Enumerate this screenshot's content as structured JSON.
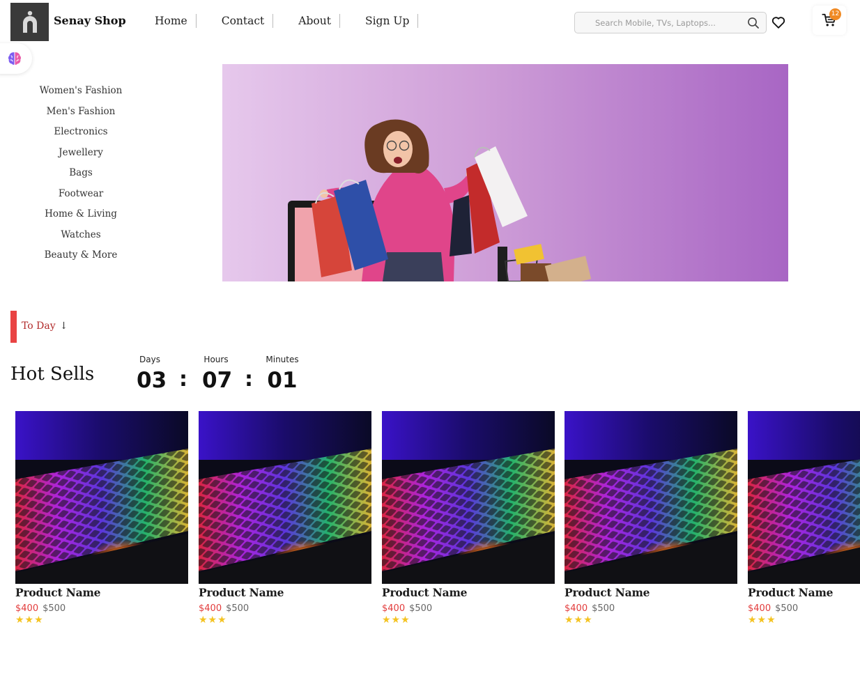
{
  "brand": {
    "name": "Senay Shop"
  },
  "nav": {
    "items": [
      "Home",
      "Contact",
      "About",
      "Sign Up"
    ]
  },
  "search": {
    "placeholder": "Search Mobile, TVs, Laptops..."
  },
  "cart": {
    "count": "12"
  },
  "categories": [
    "Women's Fashion",
    "Men's Fashion",
    "Electronics",
    "Jewellery",
    "Bags",
    "Footwear",
    "Home & Living",
    "Watches",
    "Beauty & More"
  ],
  "section": {
    "today_label": "To Day",
    "today_arrow": "↓",
    "title": "Hot Sells"
  },
  "countdown": {
    "days_label": "Days",
    "days": "03",
    "hours_label": "Hours",
    "hours": "07",
    "minutes_label": "Minutes",
    "minutes": "01",
    "separator": ":"
  },
  "products": [
    {
      "name": "Product Name",
      "price": "$400",
      "old_price": "$500",
      "stars": "★★★"
    },
    {
      "name": "Product Name",
      "price": "$400",
      "old_price": "$500",
      "stars": "★★★"
    },
    {
      "name": "Product Name",
      "price": "$400",
      "old_price": "$500",
      "stars": "★★★"
    },
    {
      "name": "Product Name",
      "price": "$400",
      "old_price": "$500",
      "stars": "★★★"
    },
    {
      "name": "Product Name",
      "price": "$400",
      "old_price": "$500",
      "stars": "★★★"
    }
  ],
  "colors": {
    "accent": "#e94343",
    "price": "#e23b3b",
    "star": "#f4c322",
    "badge": "#f08a24"
  }
}
